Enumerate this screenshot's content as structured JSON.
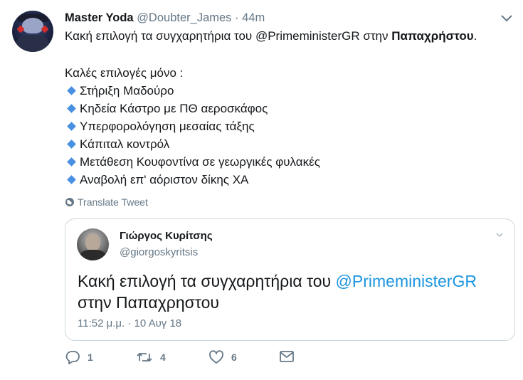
{
  "tweet": {
    "author_name": "Master Yoda",
    "handle": "@Doubter_James",
    "separator": "·",
    "time": "44m",
    "line1_prefix": "Κακή επιλογή τα συγχαρητήρια του ",
    "line1_mention": "@PrimeministerGR",
    "line1_middle": " στην ",
    "line1_bold": "Παπαχρήστου",
    "line1_suffix": ".",
    "list_intro": "Καλές επιλογές μόνο :",
    "items": [
      "Στήριξη Μαδούρο",
      "Κηδεία Κάστρο με ΠΘ αεροσκάφος",
      "Υπερφορολόγηση μεσαίας τάξης",
      "Κάπιταλ κοντρόλ",
      "Μετάθεση Κουφοντίνα σε γεωργικές φυλακές",
      "Αναβολή επ' αόριστον δίκης ΧΑ"
    ],
    "translate_label": "Translate Tweet"
  },
  "quoted": {
    "author_name": "Γιώργος Κυρίτσης",
    "handle": "@giorgoskyritsis",
    "text_prefix": "Κακή επιλογή τα συγχαρητήρια του ",
    "text_mention": "@PrimeministerGR",
    "text_line2": "στην Παπαχρηστου",
    "date": "11:52 μ.μ. · 10 Αυγ 18"
  },
  "actions": {
    "reply_count": "1",
    "retweet_count": "4",
    "like_count": "6"
  },
  "icons": {
    "avatar": "avatar-image",
    "caret": "chevron-down-icon",
    "bullet": "blue-diamond-icon",
    "translate": "globe-icon",
    "reply": "reply-icon",
    "retweet": "retweet-icon",
    "like": "heart-icon",
    "dm": "envelope-icon"
  },
  "colors": {
    "link": "#1b95e0",
    "bullet": "#4a90e2",
    "muted": "#657786",
    "border": "#ccd6dd"
  }
}
